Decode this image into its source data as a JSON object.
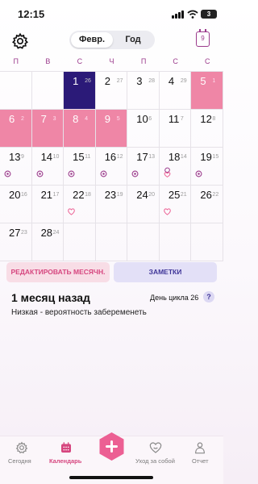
{
  "status_bar": {
    "time": "12:15",
    "battery": "3"
  },
  "header": {
    "month_tab": "Февр.",
    "year_tab": "Год",
    "today_day": "9"
  },
  "weekdays": [
    "П",
    "В",
    "С",
    "Ч",
    "П",
    "С",
    "С"
  ],
  "calendar": {
    "days": [
      {
        "n": "1",
        "c": "26",
        "state": "today"
      },
      {
        "n": "2",
        "c": "27"
      },
      {
        "n": "3",
        "c": "28"
      },
      {
        "n": "4",
        "c": "29"
      },
      {
        "n": "5",
        "c": "1",
        "state": "period"
      },
      {
        "n": "6",
        "c": "2",
        "state": "period"
      },
      {
        "n": "7",
        "c": "3",
        "state": "period"
      },
      {
        "n": "8",
        "c": "4",
        "state": "period"
      },
      {
        "n": "9",
        "c": "5",
        "state": "period"
      },
      {
        "n": "10",
        "c": "6"
      },
      {
        "n": "11",
        "c": "7"
      },
      {
        "n": "12",
        "c": "8"
      },
      {
        "n": "13",
        "c": "9",
        "mark": "ovulation"
      },
      {
        "n": "14",
        "c": "10",
        "mark": "ovulation"
      },
      {
        "n": "15",
        "c": "11",
        "mark": "ovulation"
      },
      {
        "n": "16",
        "c": "12",
        "mark": "ovulation"
      },
      {
        "n": "17",
        "c": "13",
        "mark": "ovulation"
      },
      {
        "n": "18",
        "c": "14",
        "mark": "ovulation-heart"
      },
      {
        "n": "19",
        "c": "15",
        "mark": "ovulation"
      },
      {
        "n": "20",
        "c": "16"
      },
      {
        "n": "21",
        "c": "17"
      },
      {
        "n": "22",
        "c": "18",
        "mark": "heart"
      },
      {
        "n": "23",
        "c": "19"
      },
      {
        "n": "24",
        "c": "20"
      },
      {
        "n": "25",
        "c": "21",
        "mark": "heart"
      },
      {
        "n": "26",
        "c": "22"
      },
      {
        "n": "27",
        "c": "23"
      },
      {
        "n": "28",
        "c": "24"
      }
    ]
  },
  "actions": {
    "edit_label": "РЕДАКТИРОВАТЬ МЕСЯЧН.",
    "notes_label": "ЗАМЕТКИ"
  },
  "info": {
    "title": "1 месяц назад",
    "cycle_day": "День цикла 26",
    "help": "?",
    "subtitle": "Низкая - вероятность забеременеть"
  },
  "nav": {
    "today": "Сегодня",
    "calendar": "Календарь",
    "selfcare": "Уход за собой",
    "report": "Отчет"
  },
  "colors": {
    "accent": "#d6467f",
    "period": "#ef86a6",
    "today": "#2b1a78",
    "purple": "#9b3b8c"
  }
}
